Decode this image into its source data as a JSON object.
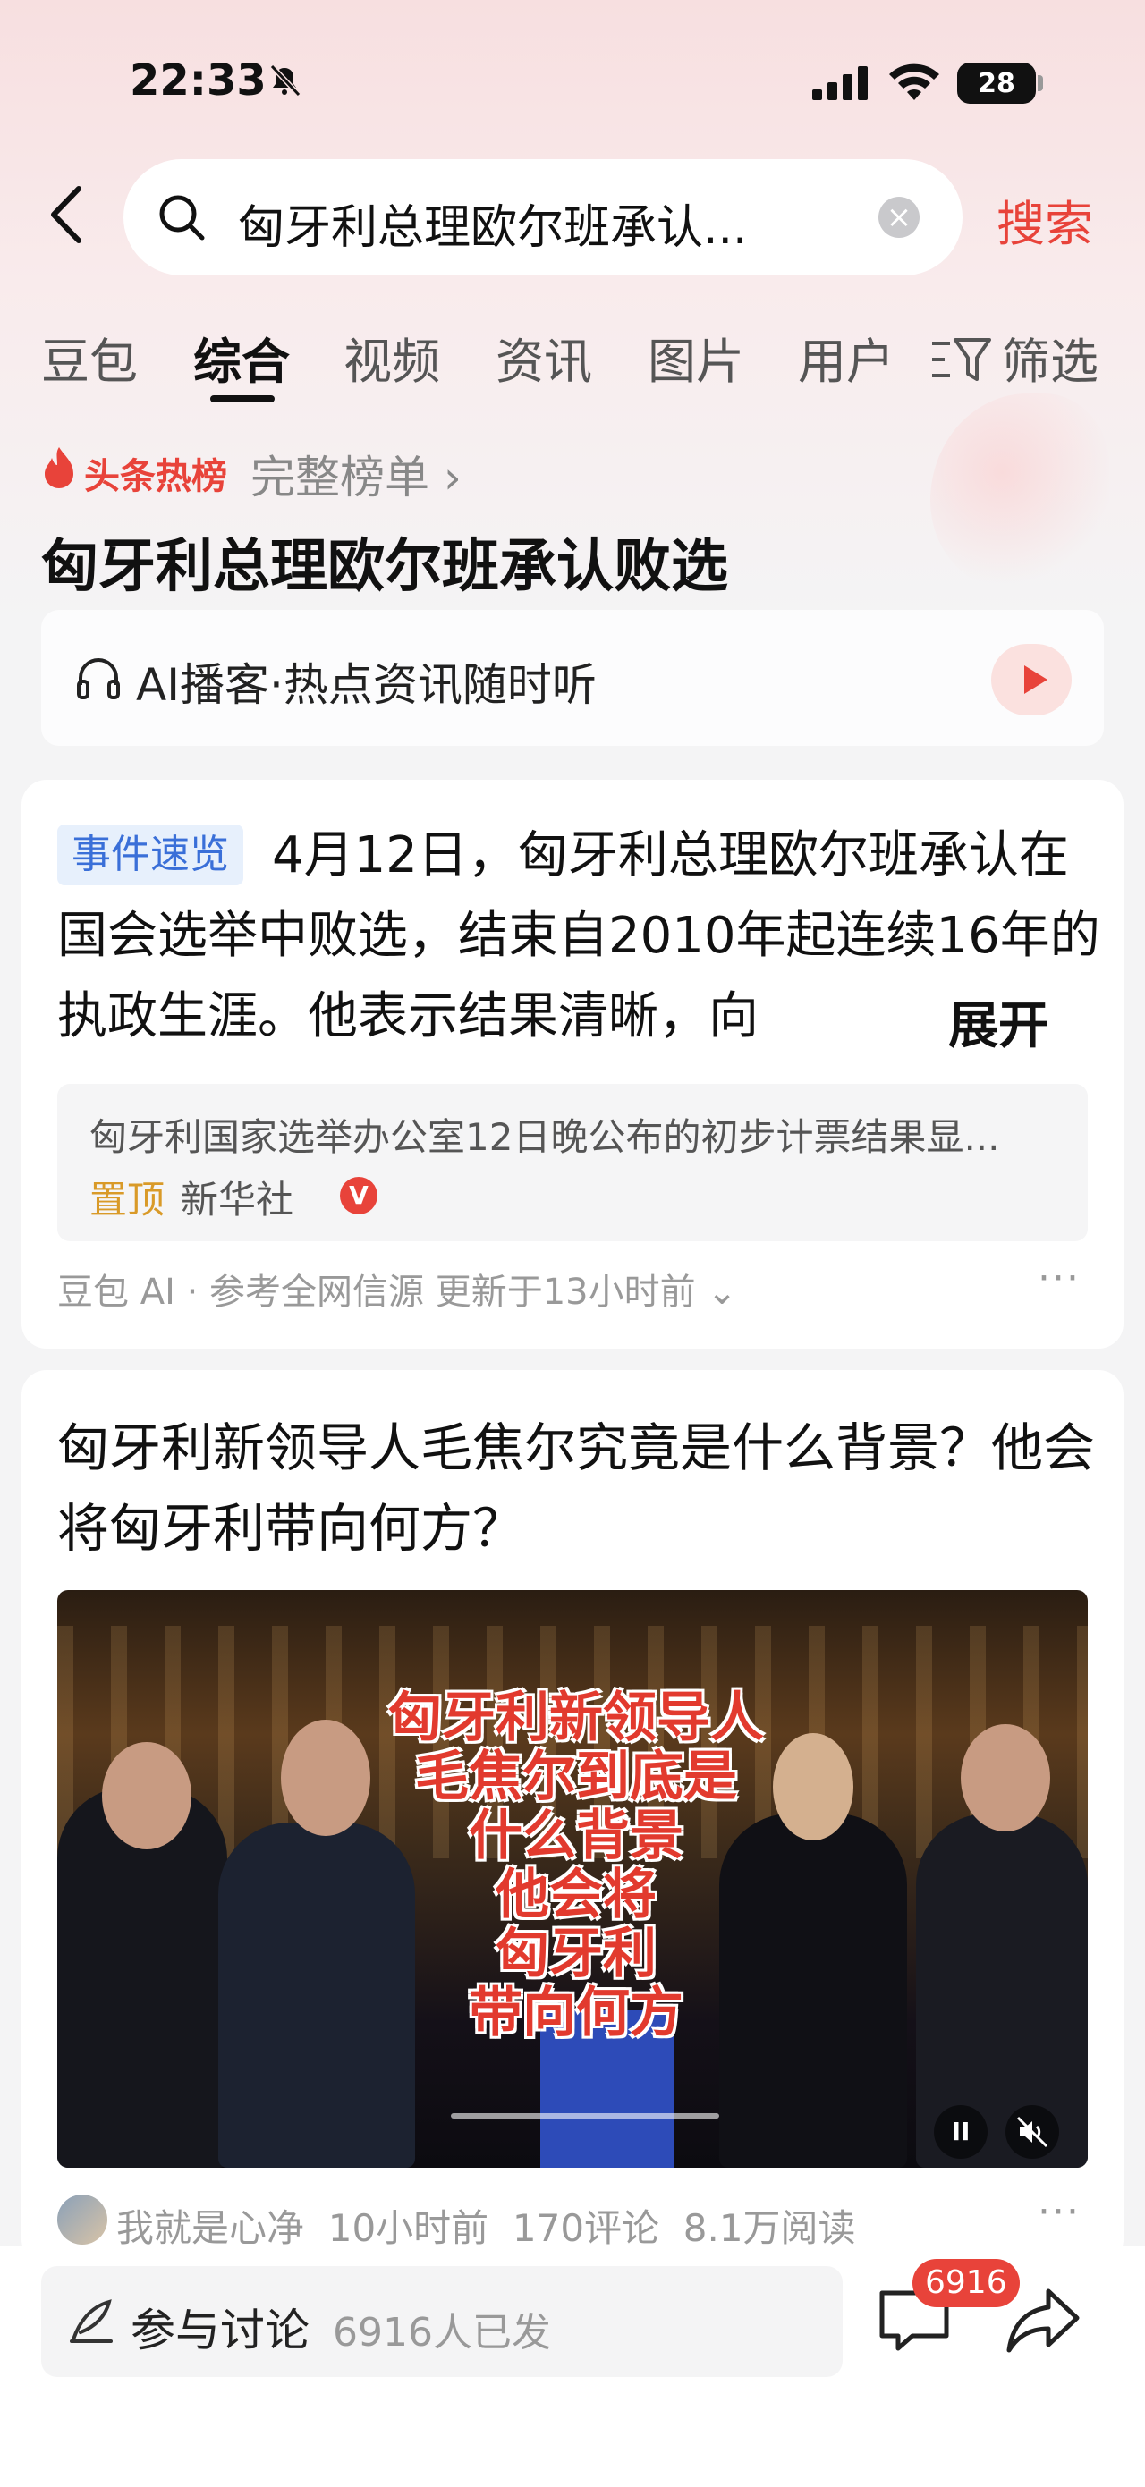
{
  "status_bar": {
    "time": "22:33",
    "battery": "28"
  },
  "search": {
    "query": "匈牙利总理欧尔班承认...",
    "submit_label": "搜索"
  },
  "tabs": [
    {
      "label": "豆包"
    },
    {
      "label": "综合"
    },
    {
      "label": "视频"
    },
    {
      "label": "资讯"
    },
    {
      "label": "图片"
    },
    {
      "label": "用户"
    },
    {
      "label": "筛选"
    }
  ],
  "hot": {
    "badge": "头条热榜",
    "full_list": "完整榜单 ›",
    "title": "匈牙利总理欧尔班承认败选",
    "podcast": "AI播客·热点资讯随时听"
  },
  "event_card": {
    "badge": "事件速览",
    "summary": "4月12日，匈牙利总理欧尔班承认在国会选举中败选，结束自2010年起连续16年的执政生涯。他表示结果清晰，向",
    "expand": "展开",
    "quote": "匈牙利国家选举办公室12日晚公布的初步计票结果显...",
    "pin": "置顶",
    "source": "新华社",
    "verified": "V",
    "footer": "豆包 AI · 参考全网信源  更新于13小时前"
  },
  "article": {
    "title": "匈牙利新领导人毛焦尔究竟是什么背景？他会将匈牙利带向何方？",
    "video_overlay": [
      "匈牙利新领导人",
      "毛焦尔到底是",
      "什么背景",
      "他会将",
      "匈牙利",
      "带向何方"
    ],
    "author": "我就是心净",
    "time": "10小时前",
    "comments": "170评论",
    "reads": "8.1万阅读"
  },
  "bottom_bar": {
    "discuss_label": "参与讨论",
    "discuss_count": "6916人已发",
    "comment_badge": "6916"
  },
  "colors": {
    "accent": "#e8433a",
    "badge_blue": "#3a6fd8",
    "pin_gold": "#d99a28"
  }
}
